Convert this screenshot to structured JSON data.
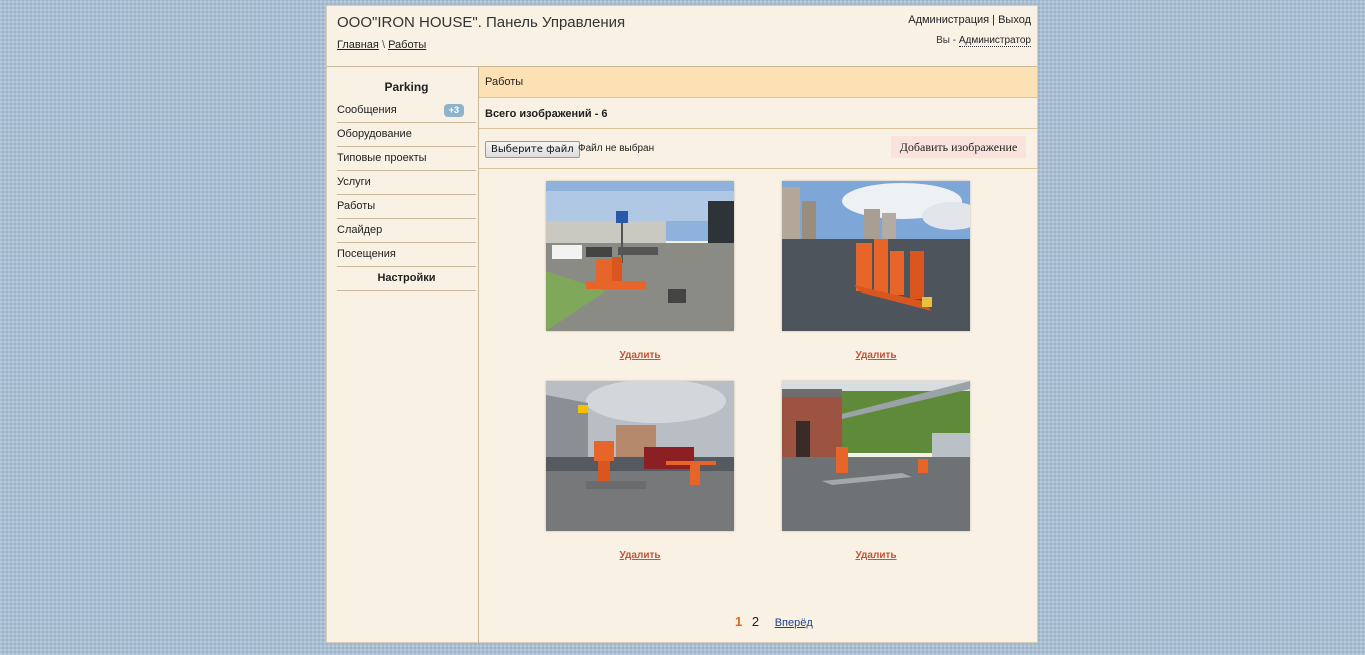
{
  "header": {
    "title": "ООО\"IRON HOUSE\". Панель Управления",
    "breadcrumb_home": "Главная",
    "breadcrumb_sep": "\\",
    "breadcrumb_current": "Работы",
    "admin_link": "Администрация",
    "sep": "|",
    "logout_link": "Выход",
    "you_label": "Вы -",
    "user_role": "Администратор"
  },
  "sidebar": {
    "title": "Parking",
    "items": [
      {
        "label": "Сообщения",
        "badge": "+3"
      },
      {
        "label": "Оборудование"
      },
      {
        "label": "Типовые проекты"
      },
      {
        "label": "Услуги"
      },
      {
        "label": "Работы"
      },
      {
        "label": "Слайдер"
      },
      {
        "label": "Посещения"
      }
    ],
    "settings_label": "Настройки"
  },
  "content": {
    "section_title": "Работы",
    "count_text": "Всего изображений - 6",
    "file_button": "Выберите файл",
    "file_status": "Файл не выбран",
    "add_button": "Добавить изображение",
    "delete_label": "Удалить",
    "images": [
      {
        "alt": "parking barrier with sign",
        "colors": {
          "sky": "#8fb2dd",
          "ground": "#8b8b86",
          "accent": "#e8652a"
        }
      },
      {
        "alt": "parking barriers under clouds",
        "colors": {
          "sky": "#7ea6d6",
          "ground": "#4e545c",
          "accent": "#e8652a"
        }
      },
      {
        "alt": "barrier at shopping mall",
        "colors": {
          "sky": "#b9bec5",
          "ground": "#77787a",
          "accent": "#e8652a"
        }
      },
      {
        "alt": "barrier near brick building",
        "colors": {
          "sky": "#d8dde0",
          "ground": "#6f7275",
          "accent": "#e8652a"
        }
      }
    ]
  },
  "pager": {
    "current": "1",
    "page2": "2",
    "next": "Вперёд"
  },
  "colors": {
    "background": "#a9bfd6",
    "panel": "#f8f1e4",
    "header_bar": "#fbe1b3",
    "delete_link": "#c0553a",
    "pager_current": "#d76b1e"
  }
}
